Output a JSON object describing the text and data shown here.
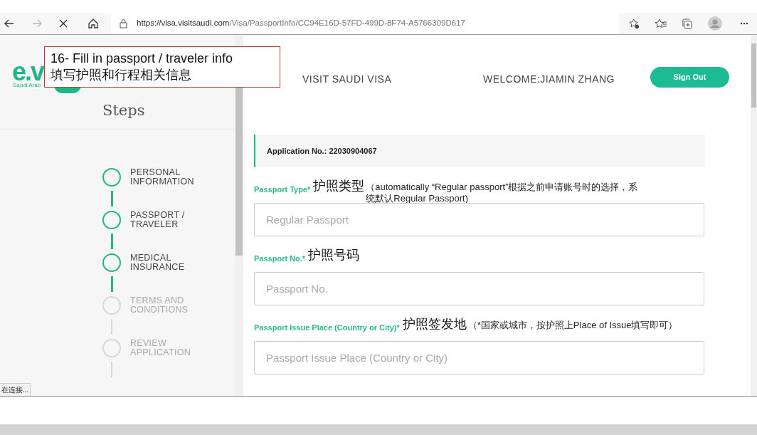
{
  "browser": {
    "url_host": "https://visa.visitsaudi.com",
    "url_path": "/Visa/PassportInfo/CC94E16D-57FD-499D-8F74-A5766309D617",
    "status_text": "在连接..."
  },
  "annotation": {
    "title": "16- Fill in passport / traveler info",
    "subtitle": "填写护照和行程相关信息"
  },
  "logo": {
    "mark": "e.v",
    "caption": "Saudi Arab"
  },
  "header": {
    "site_title": "VISIT SAUDI VISA",
    "welcome": "WELCOME:JIAMIN ZHANG",
    "sign_out": "Sign Out"
  },
  "sidebar": {
    "heading": "Steps",
    "steps": [
      {
        "line1": "PERSONAL",
        "line2": "INFORMATION",
        "done": true
      },
      {
        "line1": "PASSPORT /",
        "line2": "TRAVELER",
        "done": true
      },
      {
        "line1": "MEDICAL",
        "line2": "INSURANCE",
        "done": true
      },
      {
        "line1": "TERMS AND",
        "line2": "CONDITIONS",
        "done": false
      },
      {
        "line1": "REVIEW",
        "line2": "APPLICATION",
        "done": false
      }
    ]
  },
  "application_no": "Application No.: 22030904067",
  "fields": [
    {
      "label": "Passport Type*",
      "note_title": "护照类型",
      "note": "（automatically “Regular passport”根据之前申请账号时的选择，系统默认Regular Passport)",
      "placeholder": "Regular Passport"
    },
    {
      "label": "Passport No.*",
      "note_title": "护照号码",
      "placeholder": "Passport No."
    },
    {
      "label": "Passport Issue Place (Country or City)*",
      "note_title": "护照签发地",
      "note": "（*国家或城市，按护照上Place of Issue填写即可）",
      "placeholder": "Passport Issue Place (Country or City)"
    }
  ]
}
